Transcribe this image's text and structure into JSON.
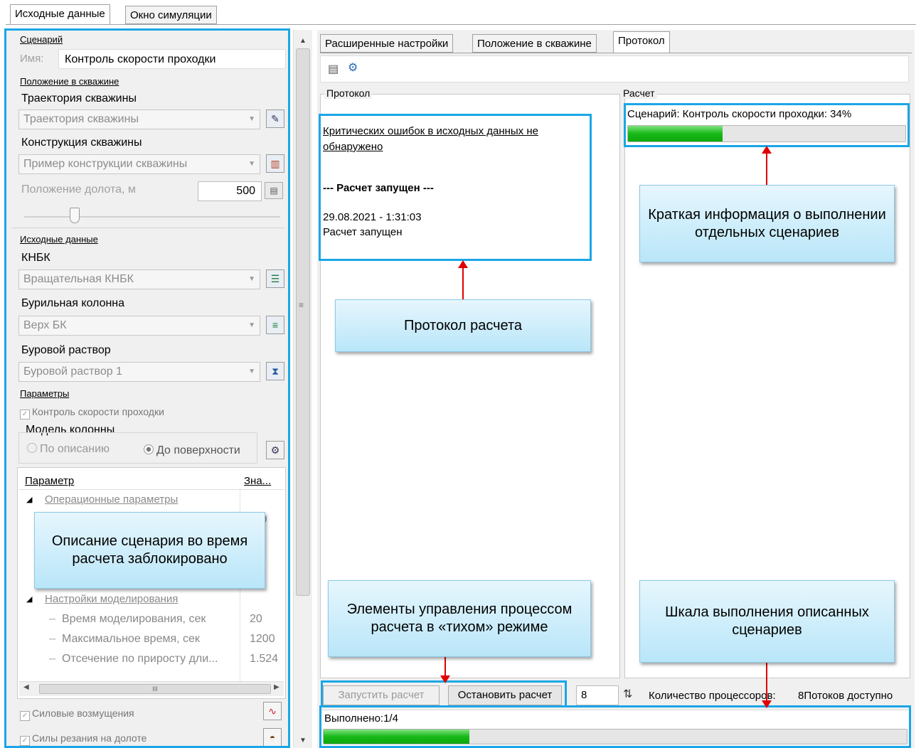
{
  "top_tabs": [
    "Исходные данные",
    "Окно симуляции"
  ],
  "left": {
    "scenario_group": "Сценарий",
    "name_label": "Имя:",
    "name_value": "Контроль скорости проходки",
    "position_group": "Положение в скважине",
    "trajectory_label": "Траектория скважины",
    "trajectory_value": "Траектория скважины",
    "construction_label": "Конструкция скважины",
    "construction_value": "Пример конструкции скважины",
    "bit_position_label": "Положение долота, м",
    "bit_position_value": "500",
    "input_group": "Исходные данные",
    "knbk_label": "КНБК",
    "knbk_value": "Вращательная КНБК",
    "drill_string_label": "Бурильная колонна",
    "drill_string_value": "Верх БК",
    "mud_label": "Буровой раствор",
    "mud_value": "Буровой раствор 1",
    "params_group": "Параметры",
    "rop_control": "Контроль скорости проходки",
    "column_model_label": "Модель колонны",
    "radio_description": "По описанию",
    "radio_surface": "До поверхности",
    "table_header_param": "Параметр",
    "table_header_value": "Зна...",
    "op_params": "Операционные параметры",
    "op_partial_value": "0",
    "sim_settings": "Настройки моделирования",
    "rows": [
      {
        "name": "Время моделирования, сек",
        "value": "20"
      },
      {
        "name": "Максимальное время, сек",
        "value": "1200"
      },
      {
        "name": "Отсечение по приросту дли...",
        "value": "1.524"
      }
    ],
    "scroll_mid": "III",
    "force_perturbations": "Силовые возмущения",
    "cutting_forces": "Силы резания на долоте"
  },
  "right": {
    "tabs": [
      "Расширенные настройки",
      "Положение в скважине",
      "Протокол"
    ],
    "protocol_legend": "Протокол",
    "calc_legend": "Расчет",
    "protocol_lines": {
      "no_errors": "Критических ошибок в исходных данных не обнаружено",
      "started_header": "--- Расчет запущен ---",
      "timestamp": "29.08.2021 - 1:31:03",
      "started": "Расчет запущен"
    },
    "scenario_progress_text": "Сценарий: Контроль скорости проходки: 34%",
    "scenario_progress": 0.34,
    "start_button": "Запустить расчет",
    "stop_button": "Остановить расчет",
    "processors_value": "8",
    "processors_label": "Количество процессоров:",
    "threads_label": "8Потоков доступно",
    "done_label": "Выполнено:1/4",
    "overall_progress": 0.25
  },
  "callouts": {
    "brief_info": "Краткая информация о выполнении отдельных сценариев",
    "protocol": "Протокол расчета",
    "locked": "Описание сценария во время расчета заблокировано",
    "quiet_controls": "Элементы управления процессом расчета в «тихом» режиме",
    "scale": "Шкала выполнения описанных сценариев"
  },
  "colors": {
    "highlight": "#1aa6e6",
    "arrow": "#e00000",
    "progress": "#17b917"
  }
}
